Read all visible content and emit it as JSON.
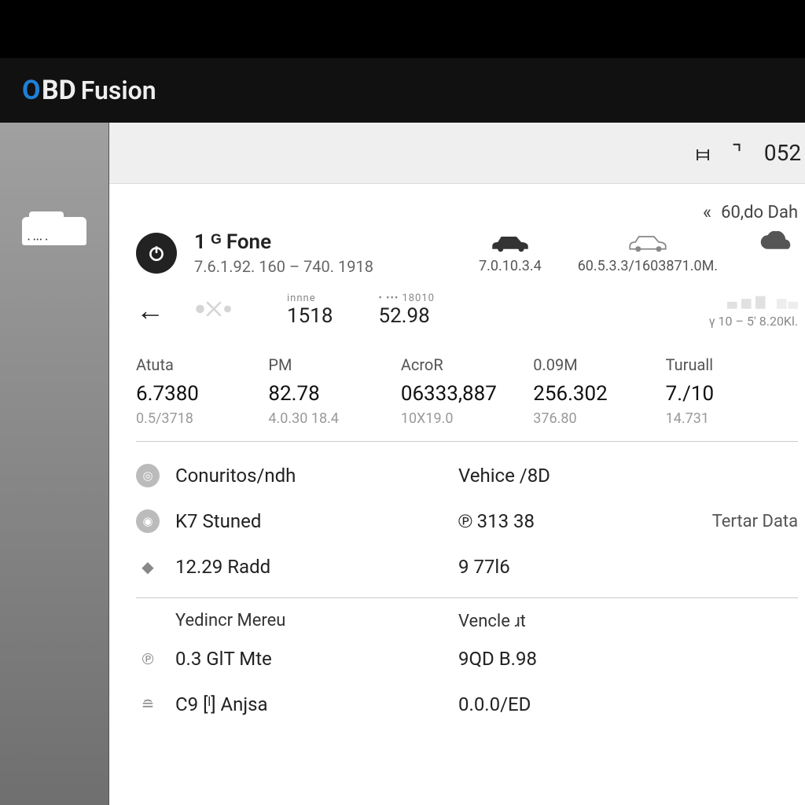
{
  "app": {
    "prefix": "O",
    "mid": "BD",
    "suffix": "Fusion"
  },
  "status": {
    "sym1": "⧦",
    "sym2": "⌝",
    "code": "052"
  },
  "toprow": {
    "chev": "«",
    "text": "60,do Dah"
  },
  "fone": {
    "title": "1 ᴳ Fone",
    "sub": "7.6.1.92. 160 – 740. 1918"
  },
  "caricons": [
    {
      "label": "7.0.10.3.4"
    },
    {
      "label": "60.5.3.3/1603871.0M."
    },
    {
      "label": ""
    }
  ],
  "metrics": {
    "m1k": "innne",
    "m1v": "1518",
    "m2k": "• •••  18010",
    "m2v": "52.98",
    "tail": "γ 10 – 5' 8.20Kl."
  },
  "stats": [
    {
      "h": "Atuta",
      "v": "6.7380",
      "s": "0.5/3718"
    },
    {
      "h": "PM",
      "v": "82.78",
      "s": "4.0.30 18.4"
    },
    {
      "h": "AcroR",
      "v": "06333,887",
      "s": "10X19.0"
    },
    {
      "h": "0.09M",
      "v": "256.302",
      "s": "376.80"
    },
    {
      "h": "Turuall",
      "v": "7./10",
      "s": "14.731"
    }
  ],
  "list1": [
    {
      "icon": "◎",
      "lbl": "Conuritos/ndh",
      "val": "Vehice /8D",
      "extra": ""
    },
    {
      "icon": "◉",
      "lbl": "K7  Stuned",
      "val": "℗ 313 38",
      "extra": "Tertar Data"
    },
    {
      "icon": "◆",
      "lbl": "12.29 Radd",
      "val": "9 77l6",
      "extra": ""
    }
  ],
  "group2": {
    "a": "Yedincr Mereu",
    "b": "Vencle ɹt"
  },
  "list2": [
    {
      "icon": "℗",
      "lbl": "0.3 GlT Mte",
      "val": "9QD B.98"
    },
    {
      "icon": "≘",
      "lbl": "C9  [ˡ] Anjsa",
      "val": "0.0.0/ED"
    }
  ]
}
